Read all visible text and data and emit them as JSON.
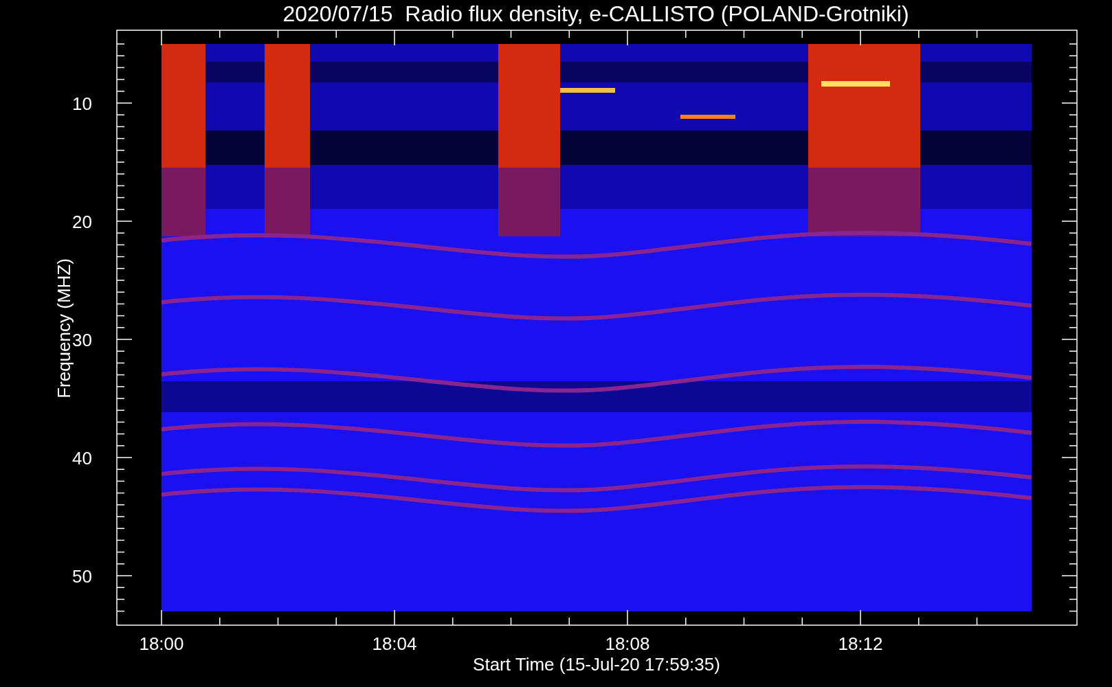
{
  "title": "2020/07/15  Radio flux density, e-CALLISTO (POLAND-Grotniki)",
  "y_axis": {
    "label": "Frequency (MHZ)",
    "ticks": [
      "10",
      "20",
      "30",
      "40",
      "50"
    ]
  },
  "x_axis": {
    "label": "Start Time (15-Jul-20 17:59:35)",
    "ticks": [
      "18:00",
      "18:04",
      "18:08",
      "18:12"
    ]
  }
}
